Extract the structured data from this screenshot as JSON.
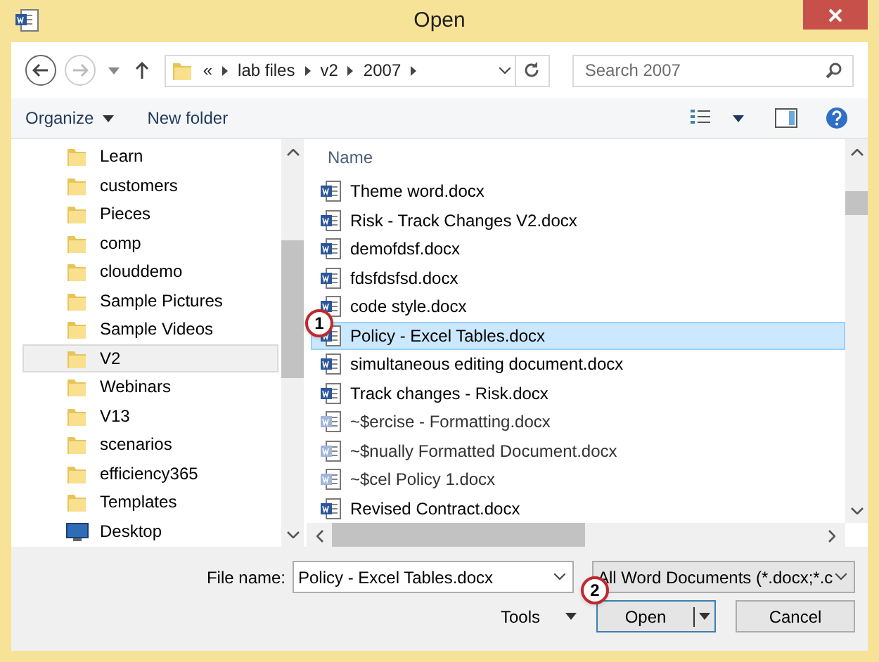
{
  "window": {
    "title": "Open"
  },
  "address": {
    "crumbs": [
      "«",
      "lab files",
      "v2",
      "2007"
    ]
  },
  "search": {
    "placeholder": "Search 2007"
  },
  "toolbar": {
    "organize": "Organize",
    "new_folder": "New folder"
  },
  "nav": [
    {
      "label": "Learn",
      "kind": "folder",
      "selected": false
    },
    {
      "label": "customers",
      "kind": "folder",
      "selected": false
    },
    {
      "label": "Pieces",
      "kind": "folder",
      "selected": false
    },
    {
      "label": "comp",
      "kind": "folder",
      "selected": false
    },
    {
      "label": "clouddemo",
      "kind": "folder",
      "selected": false
    },
    {
      "label": "Sample Pictures",
      "kind": "folder",
      "selected": false
    },
    {
      "label": "Sample Videos",
      "kind": "folder",
      "selected": false
    },
    {
      "label": "V2",
      "kind": "folder",
      "selected": true
    },
    {
      "label": "Webinars",
      "kind": "folder",
      "selected": false
    },
    {
      "label": "V13",
      "kind": "folder",
      "selected": false
    },
    {
      "label": "scenarios",
      "kind": "folder",
      "selected": false
    },
    {
      "label": "efficiency365",
      "kind": "folder",
      "selected": false
    },
    {
      "label": "Templates",
      "kind": "folder",
      "selected": false
    },
    {
      "label": "Desktop",
      "kind": "desktop",
      "selected": false
    }
  ],
  "files": {
    "column": "Name",
    "rows": [
      {
        "name": "Theme word.docx",
        "hidden": false,
        "selected": false
      },
      {
        "name": "Risk - Track Changes V2.docx",
        "hidden": false,
        "selected": false
      },
      {
        "name": "demofdsf.docx",
        "hidden": false,
        "selected": false
      },
      {
        "name": "fdsfdsfsd.docx",
        "hidden": false,
        "selected": false
      },
      {
        "name": "code style.docx",
        "hidden": false,
        "selected": false
      },
      {
        "name": "Policy - Excel Tables.docx",
        "hidden": false,
        "selected": true,
        "callout": "1"
      },
      {
        "name": "simultaneous editing document.docx",
        "hidden": false,
        "selected": false
      },
      {
        "name": "Track changes  - Risk.docx",
        "hidden": false,
        "selected": false
      },
      {
        "name": "~$ercise - Formatting.docx",
        "hidden": true,
        "selected": false
      },
      {
        "name": "~$nually Formatted Document.docx",
        "hidden": true,
        "selected": false
      },
      {
        "name": "~$cel Policy 1.docx",
        "hidden": true,
        "selected": false
      },
      {
        "name": "Revised Contract.docx",
        "hidden": false,
        "selected": false
      }
    ]
  },
  "footer": {
    "file_name_label": "File name:",
    "file_name": "Policy - Excel Tables.docx",
    "file_type": "All Word Documents (*.docx;*.c",
    "tools": "Tools",
    "open": "Open",
    "open_callout": "2",
    "cancel": "Cancel"
  }
}
